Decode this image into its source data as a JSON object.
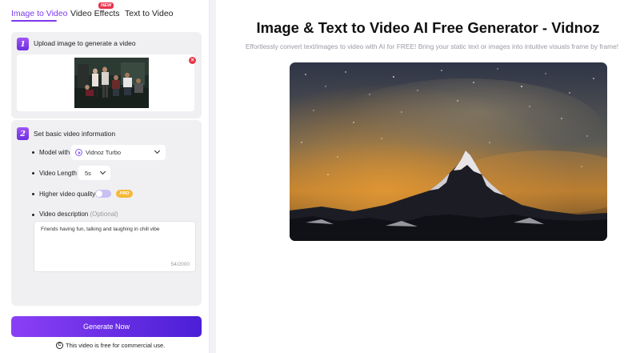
{
  "tabs": [
    {
      "label": "Image to Video",
      "active": true
    },
    {
      "label": "Video Effects",
      "badge": "NEW"
    },
    {
      "label": "Text to Video"
    }
  ],
  "step1": {
    "number": "1",
    "title": "Upload image to generate a video",
    "image_icon": "uploaded-image-thumbnail",
    "remove_icon": "close-icon"
  },
  "step2": {
    "number": "2",
    "title": "Set basic video information",
    "model_label": "Model with",
    "model_value": "Vidnoz Turbo",
    "length_label": "Video Length",
    "length_value": "5s",
    "quality_label": "Higher video quality",
    "quality_on": false,
    "pro_badge": "PRO",
    "description_label": "Video description",
    "description_optional": "(Optional)",
    "description_value": "Friends having fun, talking and laughing in chill vibe",
    "description_count": "54/2000"
  },
  "generate_label": "Generate Now",
  "footnote": "This video is free for commercial use.",
  "main": {
    "title": "Image & Text to Video AI Free Generator - Vidnoz",
    "subtitle": "Effortlessly convert text/images to video with AI for FREE! Bring your static text or images into intuitive visuals frame by frame!"
  },
  "colors": {
    "accent": "#7c3aed",
    "new_badge": "#e8344e",
    "pro_badge": "#f5b93a",
    "close": "#e23a4a"
  }
}
